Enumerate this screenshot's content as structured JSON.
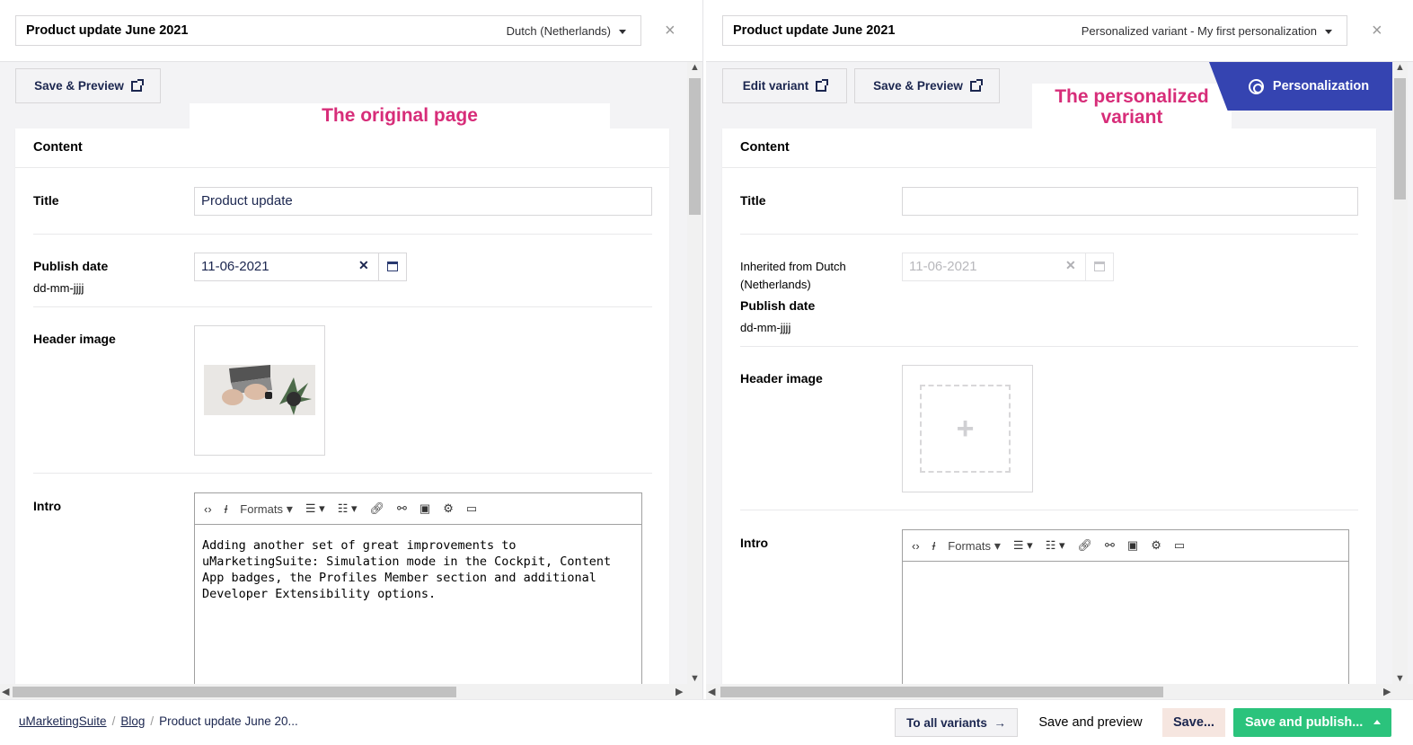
{
  "left": {
    "name": "Product update June 2021",
    "variant": "Dutch (Netherlands)",
    "save_preview": "Save & Preview",
    "callout": "The original page",
    "content_header": "Content",
    "title_label": "Title",
    "title_value": "Product update",
    "publish_label": "Publish date",
    "date_format": "dd-mm-jjjj",
    "date_value": "11-06-2021",
    "header_image_label": "Header image",
    "intro_label": "Intro",
    "formats": "Formats",
    "intro_text": "Adding another set of great improvements to uMarketingSuite: Simulation mode in the Cockpit, Content App badges, the Profiles Member section and additional Developer Extensibility options."
  },
  "right": {
    "name": "Product update June 2021",
    "variant": "Personalized variant - My first personalization",
    "edit_variant": "Edit variant",
    "save_preview": "Save & Preview",
    "callout_line1": "The personalized",
    "callout_line2": "variant",
    "personalization": "Personalization",
    "content_header": "Content",
    "title_label": "Title",
    "inherited_line1": "Inherited from Dutch",
    "inherited_line2": "(Netherlands)",
    "publish_label": "Publish date",
    "date_format": "dd-mm-jjjj",
    "date_value": "11-06-2021",
    "header_image_label": "Header image",
    "intro_label": "Intro",
    "formats": "Formats"
  },
  "footer": {
    "crumb1": "uMarketingSuite",
    "crumb2": "Blog",
    "crumb3": "Product update June 20...",
    "to_all_variants": "To all variants",
    "save_and_preview": "Save and preview",
    "save": "Save...",
    "save_publish": "Save and publish..."
  },
  "colors": {
    "accent": "#3544b1",
    "callout": "#d72d79",
    "publish": "#2bc37c"
  }
}
